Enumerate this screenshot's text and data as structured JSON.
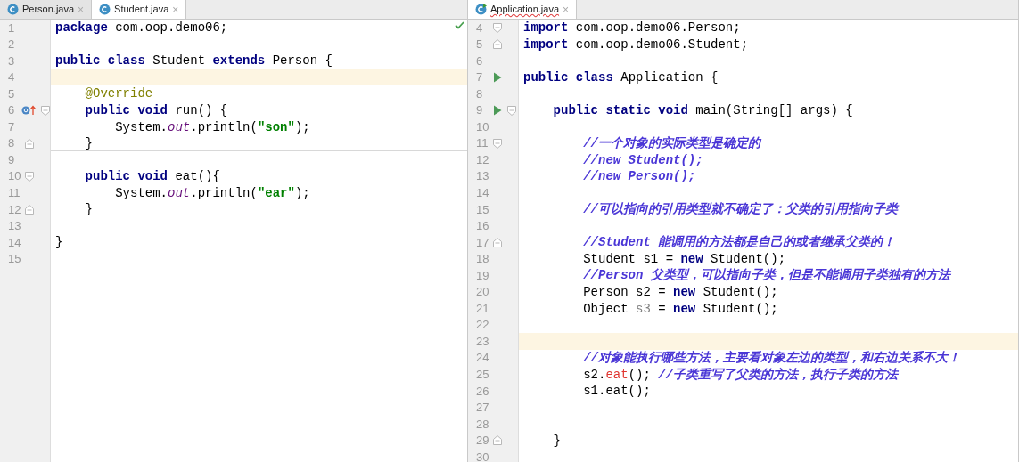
{
  "editors": [
    {
      "inspection_ok": true,
      "tabs": [
        {
          "label": "Person.java",
          "close": "×",
          "selected": false,
          "error": false,
          "runnable": false
        },
        {
          "label": "Student.java",
          "close": "×",
          "selected": true,
          "error": false,
          "runnable": false
        }
      ],
      "lines": [
        {
          "number": "1",
          "current": false,
          "tokens": [
            {
              "kind": "kw",
              "text": "package"
            },
            {
              "kind": "plain",
              "text": " com.oop.demo06;"
            }
          ]
        },
        {
          "number": "2",
          "current": false
        },
        {
          "number": "3",
          "current": false,
          "tokens": [
            {
              "kind": "kw",
              "text": "public class"
            },
            {
              "kind": "plain",
              "text": " Student "
            },
            {
              "kind": "kw",
              "text": "extends"
            },
            {
              "kind": "plain",
              "text": " Person {"
            }
          ]
        },
        {
          "number": "4",
          "current": true
        },
        {
          "number": "5",
          "current": false,
          "tokens": [
            {
              "kind": "anno",
              "text": "    @Override"
            }
          ]
        },
        {
          "number": "6",
          "current": false,
          "markers": [
            {
              "kind": "override"
            },
            {
              "kind": "fold_open"
            }
          ],
          "tokens": [
            {
              "kind": "kw",
              "text": "    public void"
            },
            {
              "kind": "plain",
              "text": " run() {"
            }
          ]
        },
        {
          "number": "7",
          "current": false,
          "tokens": [
            {
              "kind": "plain",
              "text": "        System."
            },
            {
              "kind": "field",
              "text": "out"
            },
            {
              "kind": "plain",
              "text": ".println("
            },
            {
              "kind": "str",
              "text": "\"son\""
            },
            {
              "kind": "plain",
              "text": ");"
            }
          ]
        },
        {
          "number": "8",
          "current": false,
          "separator": true,
          "markers": [
            {
              "kind": "fold_close"
            }
          ],
          "tokens": [
            {
              "kind": "plain",
              "text": "    }"
            }
          ]
        },
        {
          "number": "9",
          "current": false
        },
        {
          "number": "10",
          "current": false,
          "markers": [
            {
              "kind": "fold_open"
            }
          ],
          "tokens": [
            {
              "kind": "kw",
              "text": "    public void"
            },
            {
              "kind": "plain",
              "text": " eat(){"
            }
          ]
        },
        {
          "number": "11",
          "current": false,
          "tokens": [
            {
              "kind": "plain",
              "text": "        System."
            },
            {
              "kind": "field",
              "text": "out"
            },
            {
              "kind": "plain",
              "text": ".println("
            },
            {
              "kind": "str",
              "text": "\"ear\""
            },
            {
              "kind": "plain",
              "text": ");"
            }
          ]
        },
        {
          "number": "12",
          "current": false,
          "markers": [
            {
              "kind": "fold_close"
            }
          ],
          "tokens": [
            {
              "kind": "plain",
              "text": "    }"
            }
          ]
        },
        {
          "number": "13",
          "current": false
        },
        {
          "number": "14",
          "current": false,
          "tokens": [
            {
              "kind": "plain",
              "text": "}"
            }
          ]
        },
        {
          "number": "15",
          "current": false
        }
      ]
    },
    {
      "tabs": [
        {
          "label": "Application.java",
          "close": "×",
          "selected": true,
          "error": true,
          "runnable": true
        }
      ],
      "lines": [
        {
          "number": "4",
          "current": false,
          "markers": [
            {
              "kind": "fold_open"
            }
          ],
          "tokens": [
            {
              "kind": "kw",
              "text": "import"
            },
            {
              "kind": "plain",
              "text": " com.oop.demo06.Person;"
            }
          ]
        },
        {
          "number": "5",
          "current": false,
          "markers": [
            {
              "kind": "fold_close"
            }
          ],
          "tokens": [
            {
              "kind": "kw",
              "text": "import"
            },
            {
              "kind": "plain",
              "text": " com.oop.demo06.Student;"
            }
          ]
        },
        {
          "number": "6",
          "current": false
        },
        {
          "number": "7",
          "current": false,
          "markers": [
            {
              "kind": "run"
            }
          ],
          "tokens": [
            {
              "kind": "kw",
              "text": "public class"
            },
            {
              "kind": "plain",
              "text": " Application {"
            }
          ]
        },
        {
          "number": "8",
          "current": false
        },
        {
          "number": "9",
          "current": false,
          "markers": [
            {
              "kind": "run"
            },
            {
              "kind": "fold_open"
            }
          ],
          "tokens": [
            {
              "kind": "kw",
              "text": "    public static void"
            },
            {
              "kind": "plain",
              "text": " main(String[] args) {"
            }
          ]
        },
        {
          "number": "10",
          "current": false
        },
        {
          "number": "11",
          "current": false,
          "markers": [
            {
              "kind": "fold_open"
            }
          ],
          "tokens": [
            {
              "kind": "comment",
              "text": "        //一个对象的实际类型是确定的"
            }
          ]
        },
        {
          "number": "12",
          "current": false,
          "tokens": [
            {
              "kind": "comment",
              "text": "        //new Student();"
            }
          ]
        },
        {
          "number": "13",
          "current": false,
          "tokens": [
            {
              "kind": "comment",
              "text": "        //new Person();"
            }
          ]
        },
        {
          "number": "14",
          "current": false
        },
        {
          "number": "15",
          "current": false,
          "tokens": [
            {
              "kind": "comment",
              "text": "        //可以指向的引用类型就不确定了：父类的引用指向子类"
            }
          ]
        },
        {
          "number": "16",
          "current": false
        },
        {
          "number": "17",
          "current": false,
          "markers": [
            {
              "kind": "fold_close"
            }
          ],
          "tokens": [
            {
              "kind": "comment",
              "text": "        //Student 能调用的方法都是自己的或者继承父类的！"
            }
          ]
        },
        {
          "number": "18",
          "current": false,
          "tokens": [
            {
              "kind": "plain",
              "text": "        Student s1 = "
            },
            {
              "kind": "kw",
              "text": "new"
            },
            {
              "kind": "plain",
              "text": " Student();"
            }
          ]
        },
        {
          "number": "19",
          "current": false,
          "tokens": [
            {
              "kind": "comment",
              "text": "        //Person 父类型，可以指向子类，但是不能调用子类独有的方法"
            }
          ]
        },
        {
          "number": "20",
          "current": false,
          "tokens": [
            {
              "kind": "plain",
              "text": "        Person s2 = "
            },
            {
              "kind": "kw",
              "text": "new"
            },
            {
              "kind": "plain",
              "text": " Student();"
            }
          ]
        },
        {
          "number": "21",
          "current": false,
          "tokens": [
            {
              "kind": "plain",
              "text": "        Object "
            },
            {
              "kind": "unused",
              "text": "s3"
            },
            {
              "kind": "plain",
              "text": " = "
            },
            {
              "kind": "kw",
              "text": "new"
            },
            {
              "kind": "plain",
              "text": " Student();"
            }
          ]
        },
        {
          "number": "22",
          "current": false
        },
        {
          "number": "23",
          "current": true
        },
        {
          "number": "24",
          "current": false,
          "tokens": [
            {
              "kind": "comment",
              "text": "        //对象能执行哪些方法，主要看对象左边的类型，和右边关系不大！"
            }
          ]
        },
        {
          "number": "25",
          "current": false,
          "tokens": [
            {
              "kind": "plain",
              "text": "        s2."
            },
            {
              "kind": "error",
              "text": "eat"
            },
            {
              "kind": "plain",
              "text": "(); "
            },
            {
              "kind": "comment",
              "text": "//子类重写了父类的方法，执行子类的方法"
            }
          ]
        },
        {
          "number": "26",
          "current": false,
          "tokens": [
            {
              "kind": "plain",
              "text": "        s1.eat();"
            }
          ]
        },
        {
          "number": "27",
          "current": false
        },
        {
          "number": "28",
          "current": false
        },
        {
          "number": "29",
          "current": false,
          "markers": [
            {
              "kind": "fold_close"
            }
          ],
          "tokens": [
            {
              "kind": "plain",
              "text": "    }"
            }
          ]
        },
        {
          "number": "30",
          "current": false
        }
      ]
    }
  ]
}
